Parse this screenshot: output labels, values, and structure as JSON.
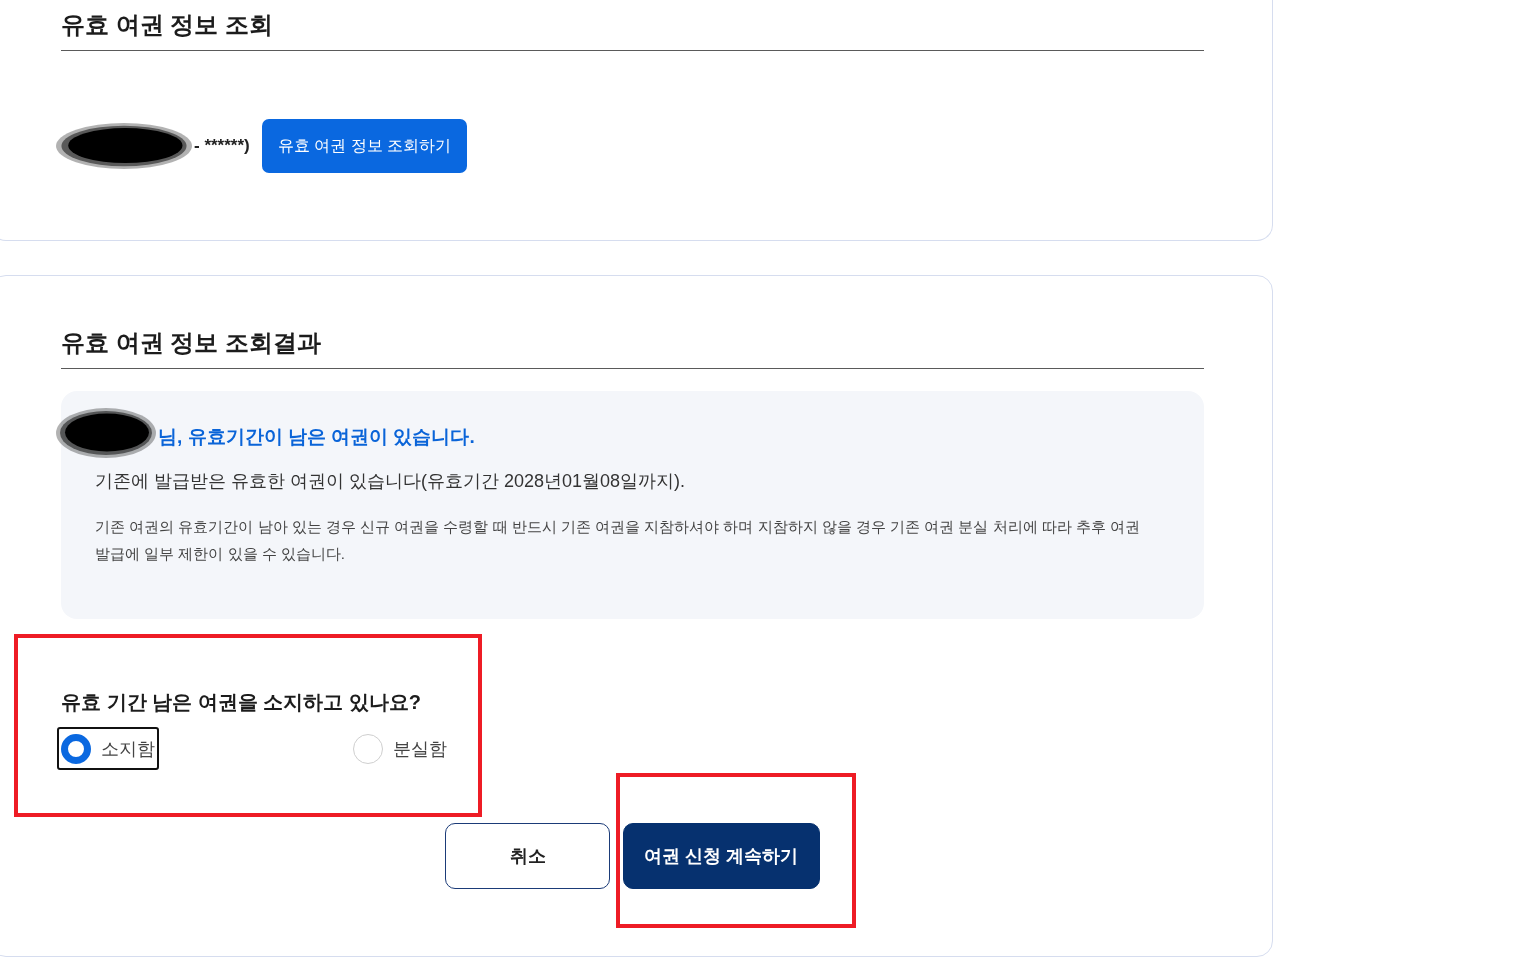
{
  "lookup_section": {
    "title": "유효 여권 정보 조회",
    "id_number": {
      "redacted": true,
      "visible_text": "- ******)"
    },
    "lookup_button": "유효 여권 정보 조회하기"
  },
  "result_section": {
    "title": "유효 여권 정보 조회결과",
    "notice": {
      "name_redacted": true,
      "headline": "님, 유효기간이 남은 여권이 있습니다.",
      "detail": "기존에 발급받은 유효한 여권이 있습니다(유효기간 2028년01월08일까지).",
      "caution": "기존 여권의 유효기간이 남아 있는 경우 신규 여권을 수령할 때 반드시 기존 여권을 지참하셔야 하며 지참하지 않을 경우 기존 여권 분실 처리에 따라 추후 여권 발급에 일부 제한이 있을 수 있습니다."
    },
    "question": {
      "label": "유효 기간 남은 여권을 소지하고 있나요?",
      "highlighted": true,
      "options": [
        {
          "label": "소지함",
          "selected": true,
          "focused": true
        },
        {
          "label": "분실함",
          "selected": false,
          "focused": false
        }
      ]
    },
    "buttons": [
      {
        "label": "취소",
        "kind": "secondary",
        "highlighted": false
      },
      {
        "label": "여권 신청 계속하기",
        "kind": "primary",
        "highlighted": true
      }
    ]
  }
}
